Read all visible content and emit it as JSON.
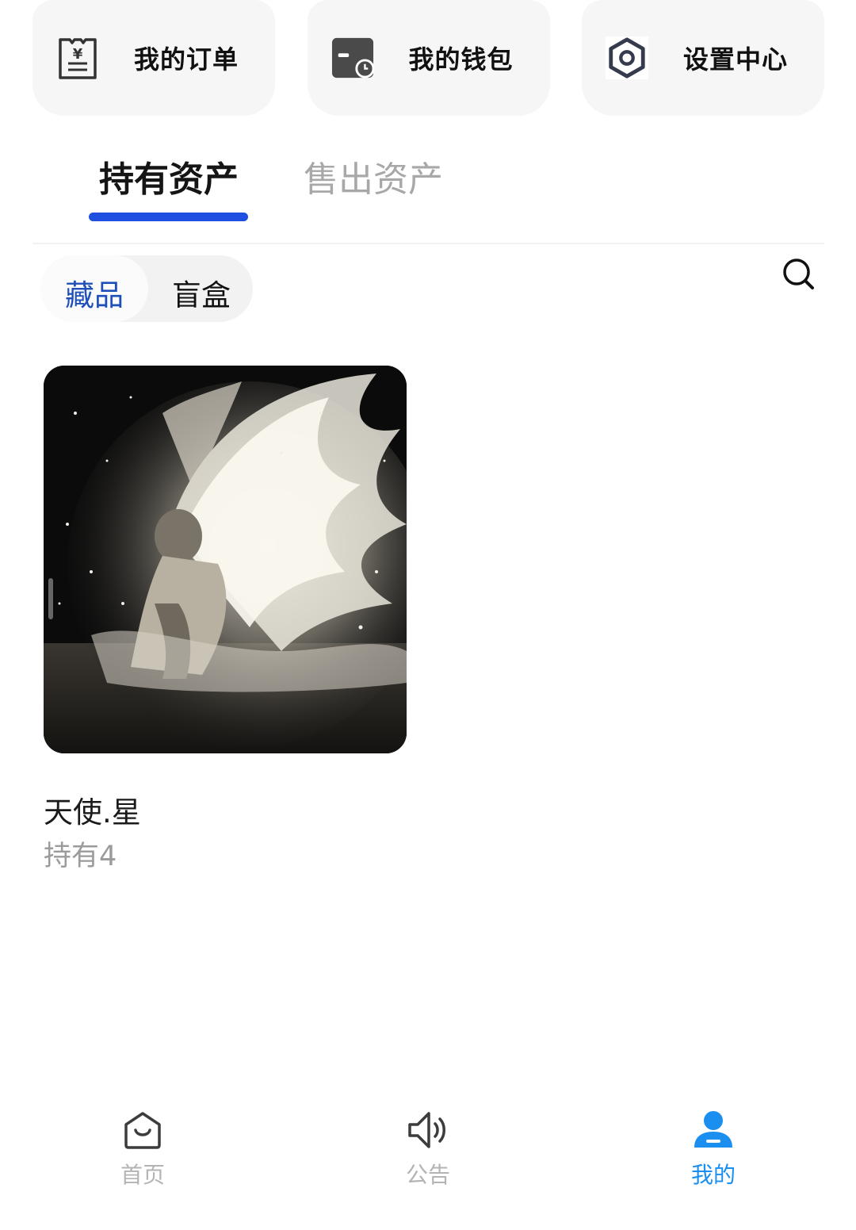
{
  "quick_actions": [
    {
      "label": "我的订单",
      "icon": "order-receipt-icon"
    },
    {
      "label": "我的钱包",
      "icon": "wallet-card-icon"
    },
    {
      "label": "设置中心",
      "icon": "settings-hex-icon"
    }
  ],
  "main_tabs": [
    {
      "label": "持有资产",
      "active": true
    },
    {
      "label": "售出资产",
      "active": false
    }
  ],
  "sub_tabs": [
    {
      "label": "藏品",
      "active": true
    },
    {
      "label": "盲盒",
      "active": false
    }
  ],
  "search": {
    "icon": "search-icon"
  },
  "collection": {
    "items": [
      {
        "name": "天使.星",
        "held": "持有4",
        "image": "angel-artwork"
      }
    ]
  },
  "bottom_nav": [
    {
      "label": "首页",
      "icon": "home-smile-icon",
      "active": false
    },
    {
      "label": "公告",
      "icon": "speaker-icon",
      "active": false
    },
    {
      "label": "我的",
      "icon": "user-icon",
      "active": true
    }
  ],
  "colors": {
    "accent": "#1f4fe0",
    "active_nav": "#1a8ff0",
    "inactive": "#a8a8a8",
    "card_bg": "#f6f6f6"
  }
}
